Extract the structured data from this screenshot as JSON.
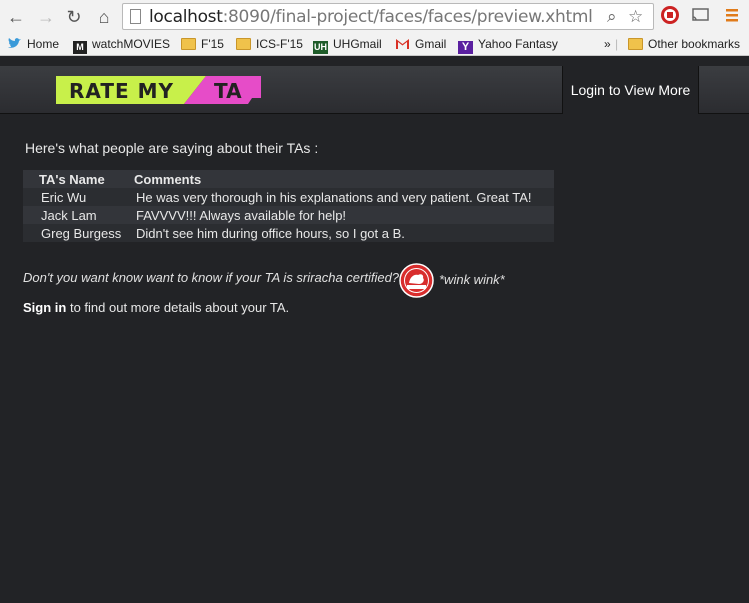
{
  "browser": {
    "url_host": "localhost",
    "url_path": ":8090/final-project/faces/faces/preview.xhtml",
    "bookmarks": [
      {
        "label": "Home",
        "icon": "twitter-icon"
      },
      {
        "label": "watchMOVIES",
        "icon": "m-logo-icon"
      },
      {
        "label": "F'15",
        "icon": "folder-icon"
      },
      {
        "label": "ICS-F'15",
        "icon": "folder-icon"
      },
      {
        "label": "UHGmail",
        "icon": "uh-logo-icon"
      },
      {
        "label": "Gmail",
        "icon": "gmail-icon"
      },
      {
        "label": "Yahoo Fantasy",
        "icon": "yahoo-icon"
      }
    ],
    "overflow_label": "»",
    "other_bookmarks": "Other bookmarks"
  },
  "site": {
    "logo_text_1": "RATE MY",
    "logo_text_2": "TA",
    "login_label": "Login to View More",
    "colors": {
      "logo_green": "#c8f04a",
      "logo_pink": "#e64cc8"
    }
  },
  "content": {
    "intro": "Here's what people are saying about their TAs :",
    "table": {
      "headers": [
        "TA's Name",
        "Comments"
      ],
      "rows": [
        {
          "name": "Eric Wu",
          "comment": "He was very thorough in his explanations and very patient. Great TA!"
        },
        {
          "name": "Jack Lam",
          "comment": "FAVVVV!!! Always available for help!"
        },
        {
          "name": "Greg Burgess",
          "comment": "Didn't see him during office hours, so I got a B."
        }
      ]
    },
    "sriracha_question": "Don't you want know want to know if your TA is sriracha certified?",
    "wink": "*wink wink*",
    "signin_link": "Sign in",
    "signin_rest": " to find out more details about your TA."
  }
}
